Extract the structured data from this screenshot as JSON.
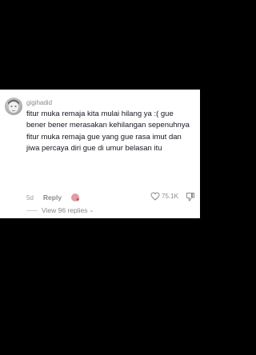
{
  "comment": {
    "username": "gigihadid",
    "text": "fitur muka remaja kita mulai hilang ya :( gue bener bener merasakan kehilangan sepenuhnya fitur muka remaja gue yang gue rasa imut dan jiwa percaya diri gue di umur belasan itu",
    "age": "5d",
    "reply_label": "Reply",
    "like_count": "75.1K",
    "view_replies_label": "View 96 replies",
    "icons": {
      "avatar": "user-avatar",
      "creator": "creator-liked-avatar",
      "like": "heart-outline-icon",
      "dislike": "thumbs-down-icon",
      "chevron": "chevron-down-icon"
    }
  },
  "colors": {
    "background": "#000000",
    "card": "#ffffff",
    "text": "#161823",
    "muted": "#8a8a8a",
    "accent": "#fe2c55"
  }
}
